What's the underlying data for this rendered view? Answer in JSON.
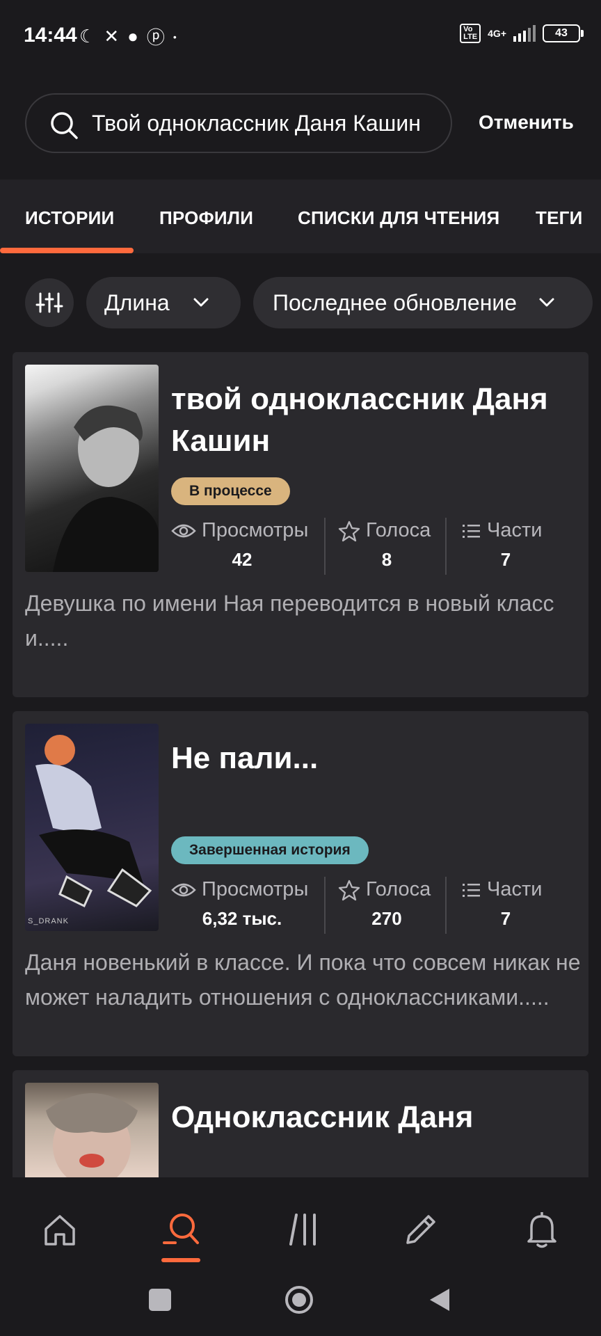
{
  "status_bar": {
    "time": "14:44",
    "network": "4G+",
    "battery": "43"
  },
  "search": {
    "value": "Твой одноклассник Даня Кашин",
    "cancel_label": "Отменить"
  },
  "tabs": [
    {
      "label": "ИСТОРИИ",
      "active": true
    },
    {
      "label": "ПРОФИЛИ",
      "active": false
    },
    {
      "label": "СПИСКИ ДЛЯ ЧТЕНИЯ",
      "active": false
    },
    {
      "label": "ТЕГИ",
      "active": false
    }
  ],
  "filters": {
    "length_label": "Длина",
    "sort_label": "Последнее обновление"
  },
  "stories": [
    {
      "title": "твой одноклассник Даня Кашин",
      "status": "В процессе",
      "status_color": "#d9b47e",
      "views_label": "Просмотры",
      "views": "42",
      "votes_label": "Голоса",
      "votes": "8",
      "parts_label": "Части",
      "parts": "7",
      "description": "Девушка по имени Ная переводится в новый класс и....."
    },
    {
      "title": "Не пали...",
      "status": "Завершенная история",
      "status_color": "#6cb8bf",
      "views_label": "Просмотры",
      "views": "6,32 тыс.",
      "votes_label": "Голоса",
      "votes": "270",
      "parts_label": "Части",
      "parts": "7",
      "description": "Даня новенький в классе. И пока что совсем никак не может наладить отношения с одноклассниками.....",
      "cover_caption": "S_DRANK"
    },
    {
      "title": "Одноклассник Даня"
    }
  ],
  "colors": {
    "accent": "#ff6a3d",
    "background": "#1b1a1d",
    "card": "#2a292d"
  },
  "bottom_nav": [
    "home-icon",
    "search-icon",
    "library-icon",
    "write-icon",
    "notifications-icon"
  ]
}
